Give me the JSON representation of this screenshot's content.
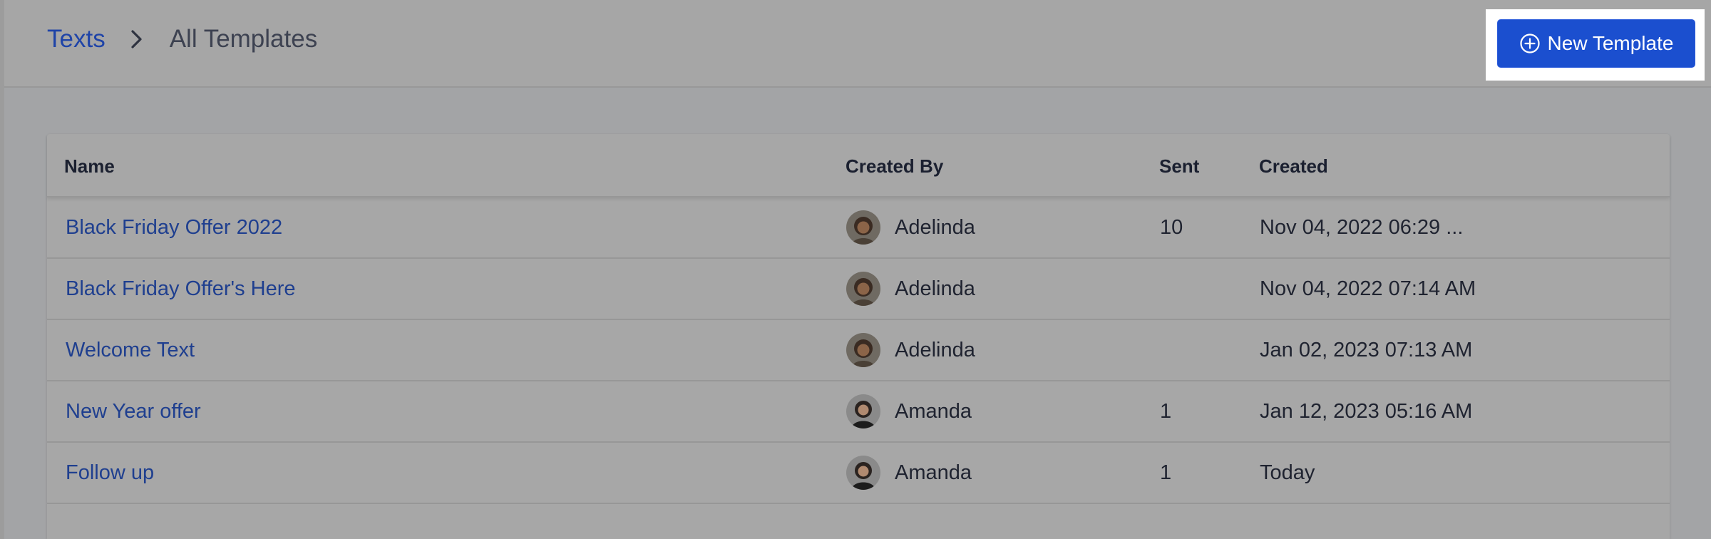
{
  "breadcrumb": {
    "root": "Texts",
    "current": "All Templates"
  },
  "actions": {
    "new_template_label": "New Template"
  },
  "table": {
    "columns": [
      "Name",
      "Created By",
      "Sent",
      "Created"
    ],
    "rows": [
      {
        "name": "Black Friday Offer 2022",
        "created_by": "Adelinda",
        "sent": "10",
        "created": "Nov 04, 2022 06:29 ...",
        "avatar": "adelinda-avatar"
      },
      {
        "name": "Black Friday Offer's Here",
        "created_by": "Adelinda",
        "sent": "",
        "created": "Nov 04, 2022 07:14 AM",
        "avatar": "adelinda-avatar"
      },
      {
        "name": "Welcome Text",
        "created_by": "Adelinda",
        "sent": "",
        "created": "Jan 02, 2023 07:13 AM",
        "avatar": "adelinda-avatar"
      },
      {
        "name": "New Year offer",
        "created_by": "Amanda",
        "sent": "1",
        "created": "Jan 12, 2023 05:16 AM",
        "avatar": "amanda-avatar"
      },
      {
        "name": "Follow up",
        "created_by": "Amanda",
        "sent": "1",
        "created": "Today",
        "avatar": "amanda-avatar"
      }
    ]
  },
  "colors": {
    "overlay_background": "#a3a4a6",
    "link": "#1f44a8",
    "primary_button": "#1b4fcf"
  }
}
